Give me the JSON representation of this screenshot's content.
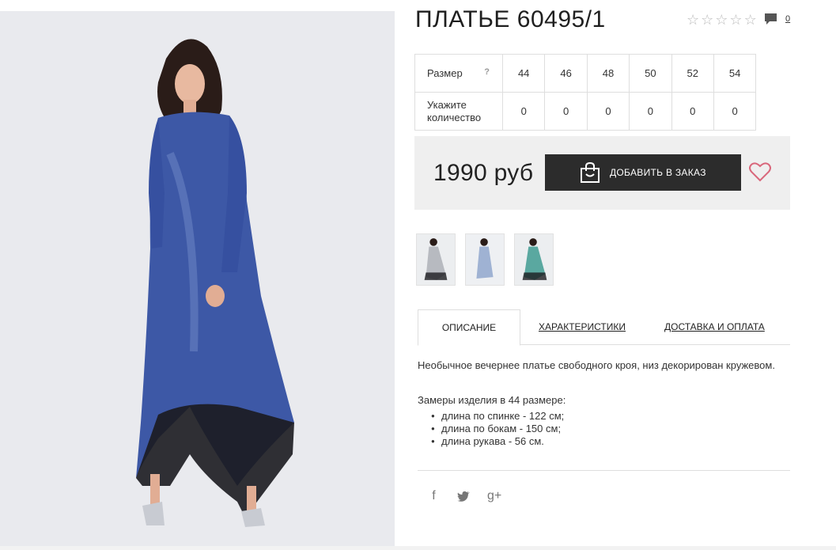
{
  "product": {
    "title": "ПЛАТЬЕ 60495/1",
    "rating_stars": [
      "☆",
      "☆",
      "☆",
      "☆",
      "☆"
    ],
    "comments_count": "0",
    "comment_icon": "comment-icon"
  },
  "sizes": {
    "size_label": "Размер",
    "help": "?",
    "values": [
      "44",
      "46",
      "48",
      "50",
      "52",
      "54"
    ],
    "quantity_label": "Укажите количество",
    "quantities": [
      "0",
      "0",
      "0",
      "0",
      "0",
      "0"
    ]
  },
  "purchase": {
    "price": "1990 руб",
    "add_button": "ДОБАВИТЬ В ЗАКАЗ",
    "bag_icon": "shopping-bag-icon",
    "wishlist_icon": "heart-icon"
  },
  "thumbnails": [
    {
      "name": "grey"
    },
    {
      "name": "light-blue"
    },
    {
      "name": "green"
    }
  ],
  "tabs": [
    {
      "label": "ОПИСАНИЕ",
      "active": true
    },
    {
      "label": "ХАРАКТЕРИСТИКИ",
      "active": false
    },
    {
      "label": "ДОСТАВКА И ОПЛАТА",
      "active": false
    }
  ],
  "description": {
    "text": "Необычное вечернее платье свободного кроя, низ декорирован кружевом.",
    "measure_title": "Замеры изделия в 44 размере:",
    "measures": [
      "длина по спинке - 122 см;",
      "длина по бокам - 150 см;",
      "длина рукава - 56 см."
    ]
  },
  "social": {
    "facebook": "f",
    "twitter": "🐦",
    "googleplus": "g+"
  },
  "colors": {
    "button_bg": "#2c2c2c",
    "price_box_bg": "#efefef",
    "heart": "#d9677b",
    "dress_blue": "#3d58a6"
  }
}
